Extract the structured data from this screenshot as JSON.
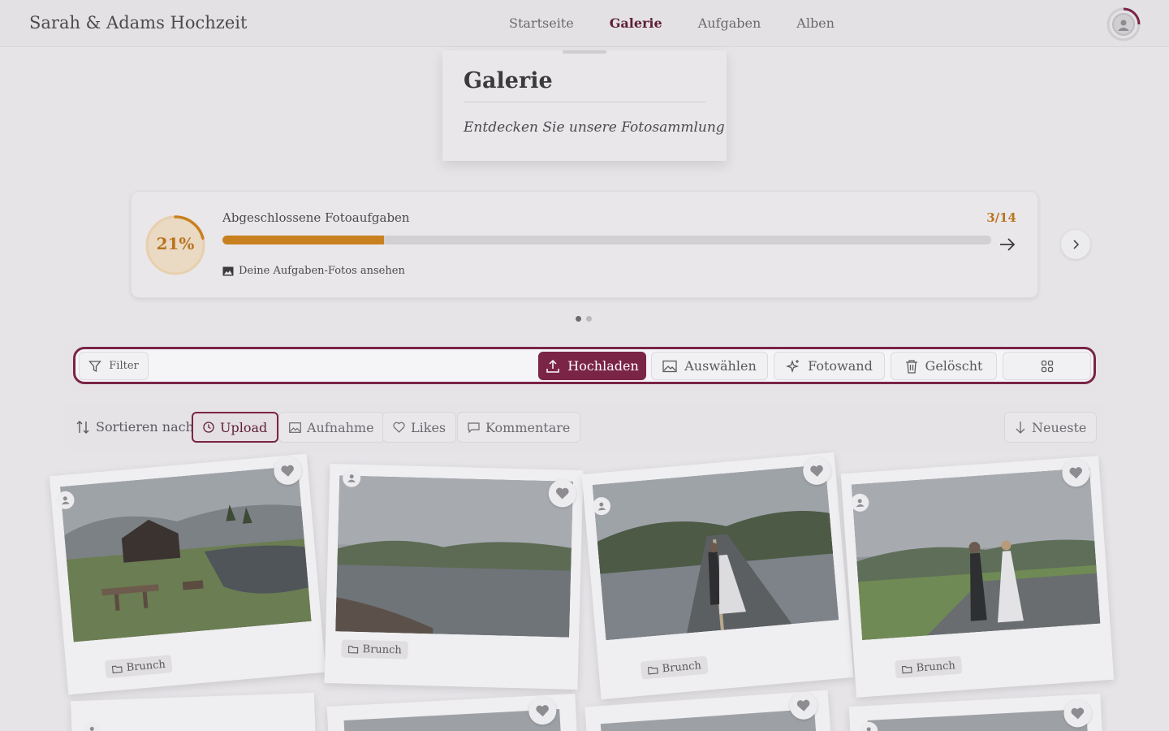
{
  "header": {
    "brand": "Sarah & Adams Hochzeit",
    "nav": [
      "Startseite",
      "Galerie",
      "Aufgaben",
      "Alben"
    ],
    "active_nav": "Galerie"
  },
  "title_card": {
    "title": "Galerie",
    "subtitle": "Entdecken Sie unsere Fotosammlung"
  },
  "progress": {
    "percent_label": "21%",
    "percent": 21,
    "title": "Abgeschlossene Fotoaufgaben",
    "count": "3/14",
    "link_label": "Deine Aufgaben-Fotos ansehen"
  },
  "toolbar": {
    "filter_label": "Filter",
    "upload_label": "Hochladen",
    "select_label": "Auswählen",
    "photowall_label": "Fotowand",
    "deleted_label": "Gelöscht"
  },
  "sort": {
    "label": "Sortieren nach",
    "options": [
      "Upload",
      "Aufnahme",
      "Likes",
      "Kommentare"
    ],
    "active": "Upload",
    "order_label": "Neueste"
  },
  "photos": [
    {
      "tag": "Brunch",
      "scene": "cabin-lake"
    },
    {
      "tag": "Brunch",
      "scene": "lake"
    },
    {
      "tag": "Brunch",
      "scene": "road-couple"
    },
    {
      "tag": "Brunch",
      "scene": "walking-couple"
    }
  ],
  "colors": {
    "accent": "#7a2446",
    "progress": "#c9801f"
  }
}
